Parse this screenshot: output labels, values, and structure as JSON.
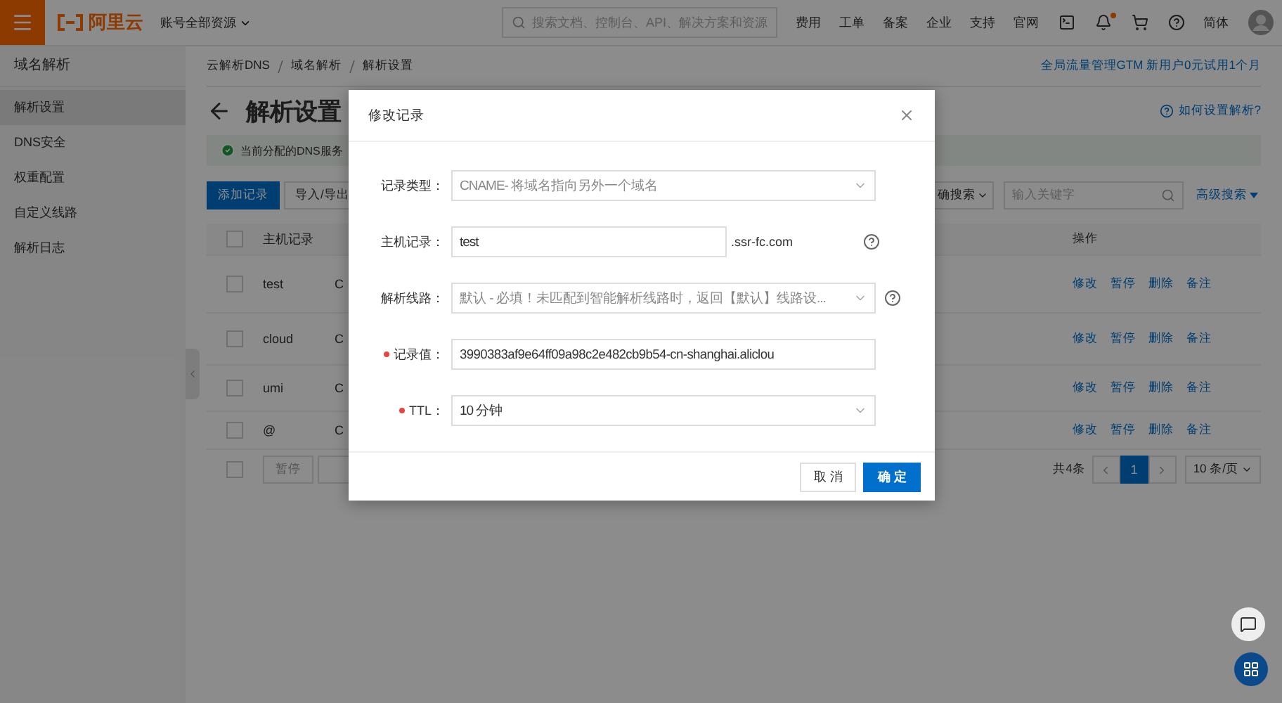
{
  "topbar": {
    "logo": "阿里云",
    "account_menu": "账号全部资源",
    "search": {
      "placeholder": "搜索文档、控制台、API、解决方案和资源"
    },
    "links": [
      "费用",
      "工单",
      "备案",
      "企业",
      "支持",
      "官网"
    ],
    "notification_dot": true,
    "language": "简体"
  },
  "sidebar": {
    "title": "域名解析",
    "items": [
      {
        "label": "解析设置",
        "selected": true
      },
      {
        "label": "DNS安全",
        "selected": false
      },
      {
        "label": "权重配置",
        "selected": false
      },
      {
        "label": "自定义线路",
        "selected": false
      },
      {
        "label": "解析日志",
        "selected": false
      }
    ]
  },
  "breadcrumb": [
    "云解析DNS",
    "域名解析",
    "解析设置"
  ],
  "promo_link": "全局流量管理GTM 新用户0元试用1个月",
  "page_title": "解析设置",
  "help_link": "如何设置解析?",
  "notice": "当前分配的DNS服务",
  "toolbar": {
    "add_button": "添加记录",
    "import_button": "导入/导出",
    "search_mode": "确搜索",
    "search": {
      "placeholder": "输入关键字"
    },
    "advanced_search": "高级搜索"
  },
  "table": {
    "header_checked": false,
    "columns": [
      "主机记录",
      "操作"
    ],
    "rows": [
      {
        "checked": false,
        "host": "test",
        "column_2": "C",
        "actions": [
          "修改",
          "暂停",
          "删除",
          "备注"
        ]
      },
      {
        "checked": false,
        "host": "cloud",
        "column_2": "C",
        "actions": [
          "修改",
          "暂停",
          "删除",
          "备注"
        ]
      },
      {
        "checked": false,
        "host": "umi",
        "column_2": "C",
        "actions": [
          "修改",
          "暂停",
          "删除",
          "备注"
        ]
      },
      {
        "checked": false,
        "host": "@",
        "column_2": "C",
        "actions": [
          "修改",
          "暂停",
          "删除",
          "备注"
        ]
      }
    ]
  },
  "footer_checked": false,
  "bulk_actions": [
    "暂停"
  ],
  "pagination": {
    "total": "共4条",
    "pages": [
      {
        "label": "1",
        "selected": true
      }
    ],
    "page_size": "10 条/页"
  },
  "modal": {
    "title": "修改记录",
    "fields": [
      {
        "kind": "select",
        "label": "记录类型：",
        "required": false,
        "value": "CNAME- 将域名指向另外一个域名",
        "help": false
      },
      {
        "kind": "input",
        "label": "主机记录：",
        "required": false,
        "value": "test",
        "suffix": ".ssr-fc.com",
        "help": true
      },
      {
        "kind": "select",
        "label": "解析线路：",
        "required": false,
        "value": "默认 - 必填！未匹配到智能解析线路时，返回【默认】线路设...",
        "help": true
      },
      {
        "kind": "input",
        "label": "记录值：",
        "required": true,
        "value": "3990383af9e64ff09a98c2e482cb9b54-cn-shanghai.aliclou",
        "help": false
      },
      {
        "kind": "select",
        "label": "TTL：",
        "required": true,
        "value": "10 分钟",
        "help": false
      }
    ],
    "buttons": [
      {
        "label": "取 消",
        "primary": false
      },
      {
        "label": "确 定",
        "primary": true
      }
    ]
  }
}
